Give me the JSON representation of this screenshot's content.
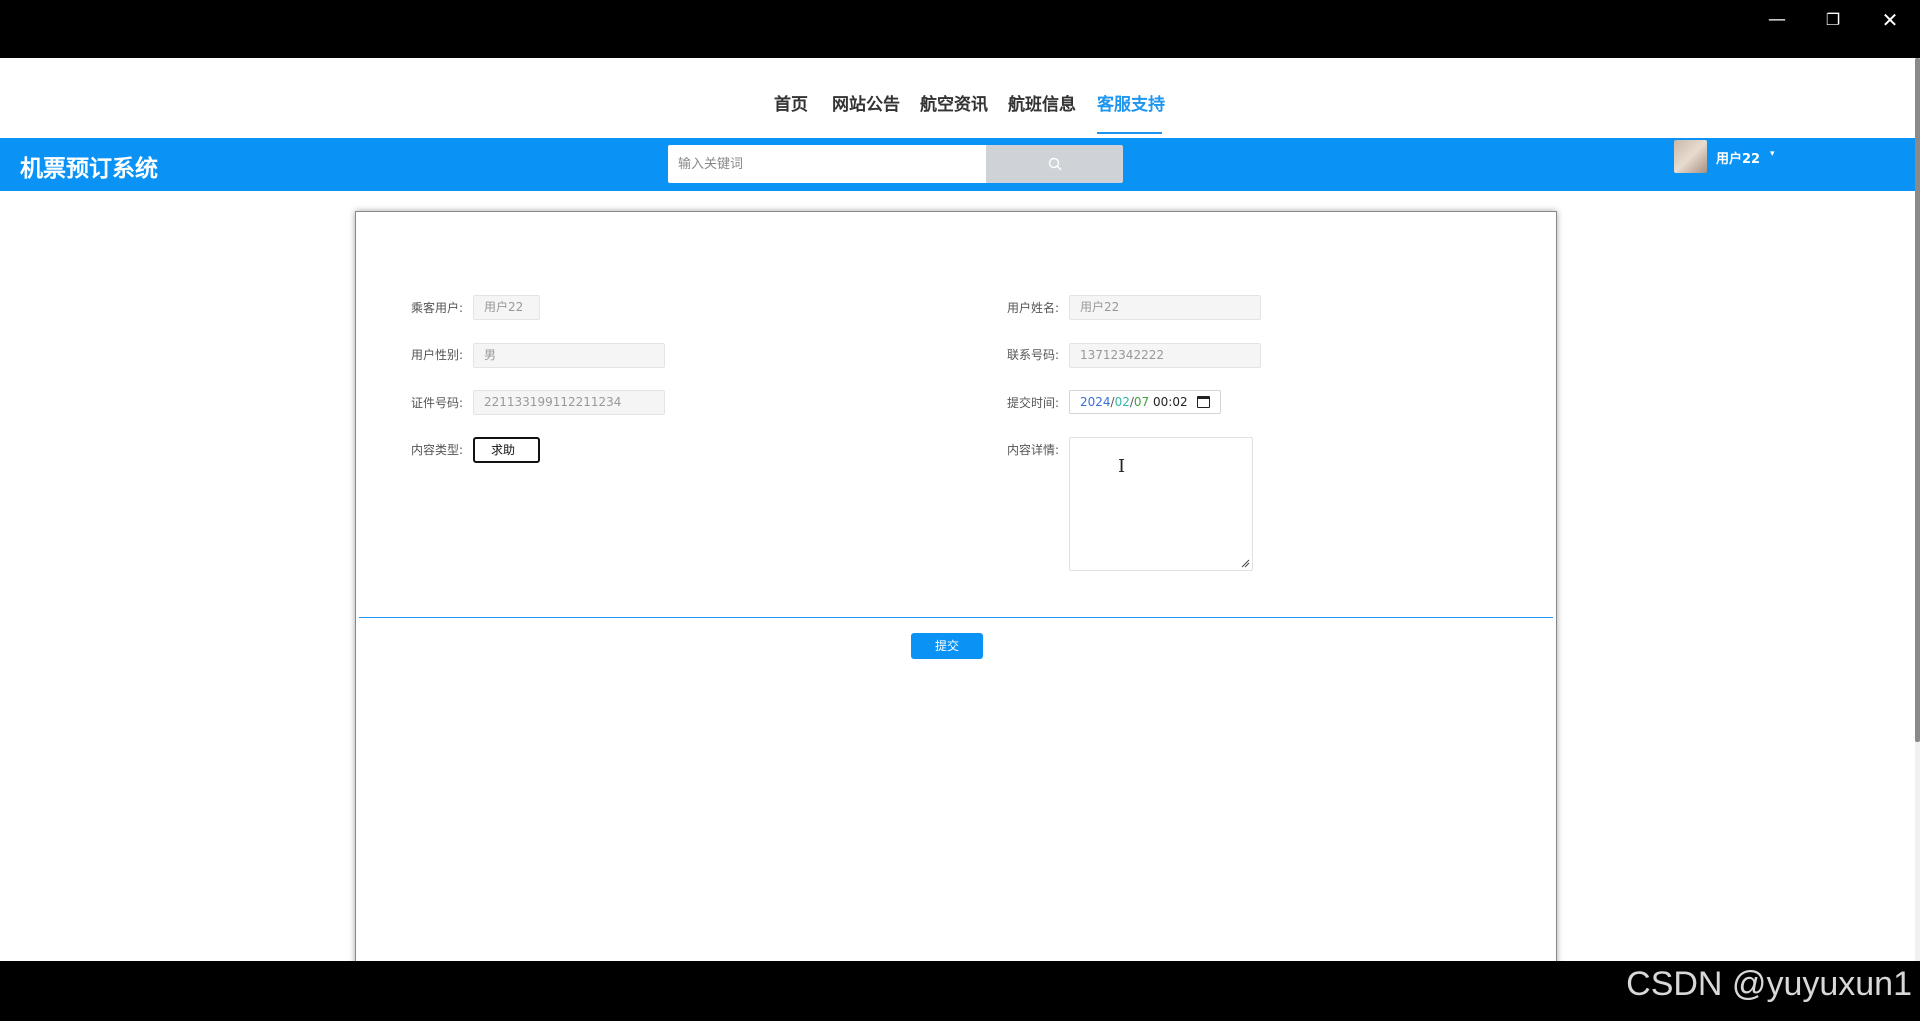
{
  "window": {
    "minimize": "—",
    "restore": "❐",
    "close": "✕"
  },
  "nav": {
    "items": [
      {
        "label": "首页"
      },
      {
        "label": "网站公告"
      },
      {
        "label": "航空资讯"
      },
      {
        "label": "航班信息"
      },
      {
        "label": "客服支持",
        "active": true
      }
    ]
  },
  "header": {
    "brand": "机票预订系统",
    "search_placeholder": "输入关键词",
    "user_name": "用户22",
    "caret": "▾",
    "accent_color": "#0a93f5"
  },
  "form": {
    "passenger_label": "乘客用户:",
    "passenger_value": "用户22",
    "gender_label": "用户性别:",
    "gender_value": "男",
    "id_label": "证件号码:",
    "id_value": "221133199112211234",
    "type_label": "内容类型:",
    "type_value": "求助",
    "name_label": "用户姓名:",
    "name_value": "用户22",
    "phone_label": "联系号码:",
    "phone_value": "13712342222",
    "time_label": "提交时间:",
    "time_value": {
      "year": "2024",
      "month": "02",
      "day": "07",
      "time": "00:02"
    },
    "detail_label": "内容详情:",
    "submit_label": "提交"
  },
  "watermark": "CSDN @yuyuxun1"
}
